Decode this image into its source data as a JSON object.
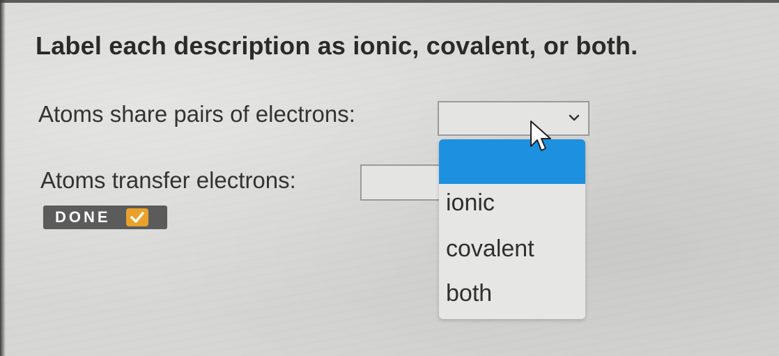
{
  "prompt": "Label each description as ionic, covalent, or both.",
  "questions": [
    {
      "text": "Atoms share pairs of electrons:",
      "value": ""
    },
    {
      "text": "Atoms transfer electrons:",
      "value": ""
    }
  ],
  "done_button": {
    "label": "DONE",
    "icon": "check-icon",
    "icon_color": "#e8a12a"
  },
  "dropdown": {
    "highlight_color": "#1e90e0",
    "options": [
      "",
      "ionic",
      "covalent",
      "both"
    ]
  }
}
